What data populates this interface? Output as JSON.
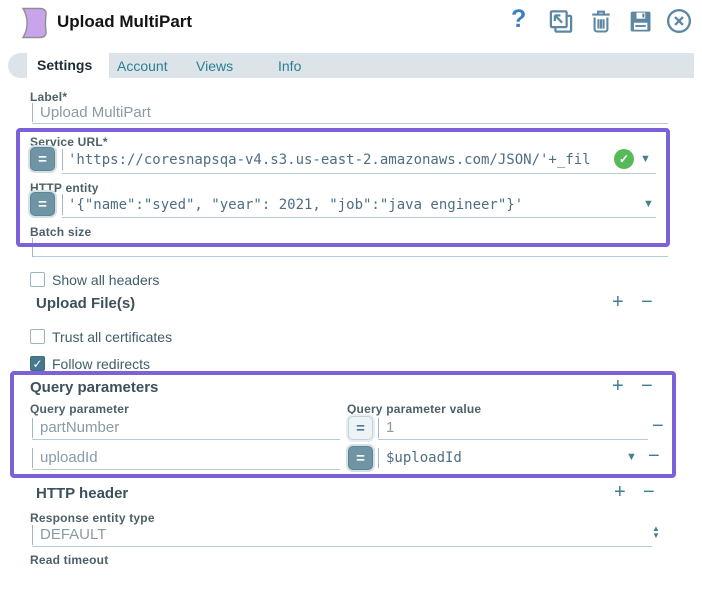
{
  "colors": {
    "accent_teal": "#3e7d94",
    "highlight_purple": "#7d61d9",
    "valid_green": "#57b957",
    "icon_slate_blue": "#5d87a3",
    "help_blue": "#3b7fc4",
    "snap_purple": "#c8a4ec",
    "checked_checkbox": "#47798c"
  },
  "glyphs": {
    "help": "?",
    "equals": "=",
    "plus": "+",
    "minus": "−",
    "dropdown_arrow": "▼",
    "checkmark": "✓",
    "spinner_up": "▲",
    "spinner_down": "▼"
  },
  "header": {
    "title": "Upload MultiPart"
  },
  "tabs": [
    {
      "label": "Settings",
      "active": true
    },
    {
      "label": "Account",
      "active": false
    },
    {
      "label": "Views",
      "active": false
    },
    {
      "label": "Info",
      "active": false
    }
  ],
  "form": {
    "label_field": {
      "label": "Label*",
      "value": "Upload MultiPart"
    },
    "service_url": {
      "label": "Service URL*",
      "value": "'https://coresnapsqa-v4.s3.us-east-2.amazonaws.com/JSON/'+_fil",
      "valid": true
    },
    "http_entity": {
      "label": "HTTP entity",
      "value": "'{\"name\":\"syed\", \"year\": 2021, \"job\":\"java engineer\"}'"
    },
    "batch_size": {
      "label": "Batch size",
      "value": ""
    },
    "show_all_headers": {
      "label": "Show all headers",
      "checked": false
    },
    "upload_files_section": {
      "title": "Upload File(s)"
    },
    "trust_all_certificates": {
      "label": "Trust all certificates",
      "checked": false
    },
    "follow_redirects": {
      "label": "Follow redirects",
      "checked": true
    },
    "query_parameters": {
      "title": "Query parameters",
      "columns": [
        "Query parameter",
        "Query parameter value"
      ],
      "rows": [
        {
          "parameter": "partNumber",
          "value": "1",
          "expression": false
        },
        {
          "parameter": "uploadId",
          "value": "$uploadId",
          "expression": true
        }
      ]
    },
    "http_header_section": {
      "title": "HTTP header"
    },
    "response_entity_type": {
      "label": "Response entity type",
      "value": "DEFAULT"
    },
    "read_timeout": {
      "label": "Read timeout"
    }
  }
}
